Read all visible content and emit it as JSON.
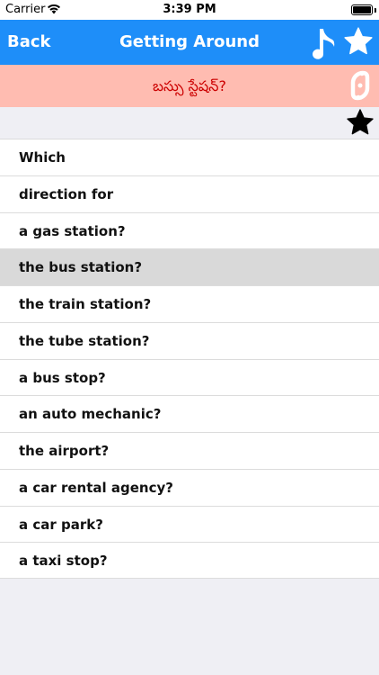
{
  "status_bar": {
    "carrier": "Carrier",
    "time": "3:39 PM",
    "wifi_icon": "wifi-icon",
    "battery_icon": "battery-full-icon"
  },
  "nav_bar": {
    "back_label": "Back",
    "title": "Getting Around",
    "music_icon": "music-note-icon",
    "favorite_icon": "star-icon",
    "background_color": "#1e8ef9"
  },
  "translation": {
    "text": "బస్సు స్టేషన్?",
    "text_color": "#cc0000",
    "background_color": "#ffbcb1",
    "speak_icon": "speak-icon"
  },
  "toolbar": {
    "favorite_icon": "star-icon"
  },
  "phrases": {
    "selected_index": 3,
    "items": [
      "Which",
      "direction for",
      "a gas station?",
      "the bus station?",
      "the train station?",
      "the tube station?",
      "a bus stop?",
      "an auto mechanic?",
      "the airport?",
      "a car rental agency?",
      "a car park?",
      "a taxi stop?"
    ]
  }
}
